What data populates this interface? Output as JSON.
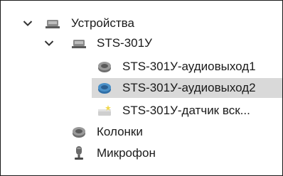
{
  "tree": {
    "root": {
      "label": "Устройства",
      "expanded": true,
      "icon": "device-group-icon"
    },
    "device": {
      "label": "STS-301У",
      "expanded": true,
      "icon": "device-group-icon"
    },
    "children": [
      {
        "label": "STS-301У-аудиовыход1",
        "icon": "speaker-icon",
        "selected": false
      },
      {
        "label": "STS-301У-аудиовыход2",
        "icon": "speaker-icon",
        "selected": true
      },
      {
        "label": "STS-301У-датчик вск...",
        "icon": "sensor-icon",
        "selected": false
      }
    ],
    "extra": [
      {
        "label": "Колонки",
        "icon": "speaker-icon"
      },
      {
        "label": "Микрофон",
        "icon": "microphone-icon"
      }
    ]
  },
  "colors": {
    "selection": "#d9d9d9",
    "speaker_blue": "#4a90c8",
    "speaker_gray": "#7a7a7a"
  }
}
